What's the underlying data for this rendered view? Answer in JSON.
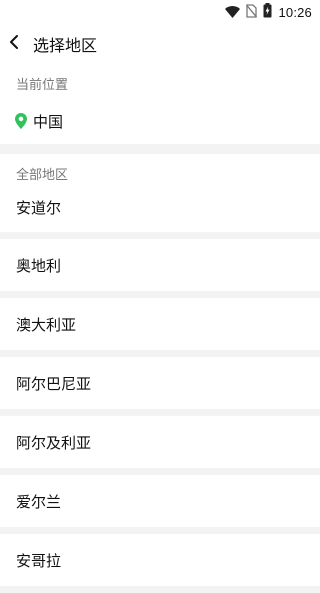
{
  "status_bar": {
    "time": "10:26",
    "icons": [
      "wifi-icon",
      "no-sim-icon",
      "battery-charging-icon"
    ]
  },
  "header": {
    "back_icon": "chevron-left-icon",
    "title": "选择地区"
  },
  "current_location": {
    "section_label": "当前位置",
    "icon": "location-pin-icon",
    "icon_color": "#2fc25b",
    "name": "中国"
  },
  "all_regions": {
    "section_label": "全部地区",
    "items": [
      {
        "label": "安道尔"
      },
      {
        "label": "奥地利"
      },
      {
        "label": "澳大利亚"
      },
      {
        "label": "阿尔巴尼亚"
      },
      {
        "label": "阿尔及利亚"
      },
      {
        "label": "爱尔兰"
      },
      {
        "label": "安哥拉"
      }
    ]
  },
  "colors": {
    "background": "#ffffff",
    "divider": "#f3f3f3",
    "secondary_text": "#777777",
    "primary_text": "#111111",
    "accent_green": "#2fc25b"
  }
}
